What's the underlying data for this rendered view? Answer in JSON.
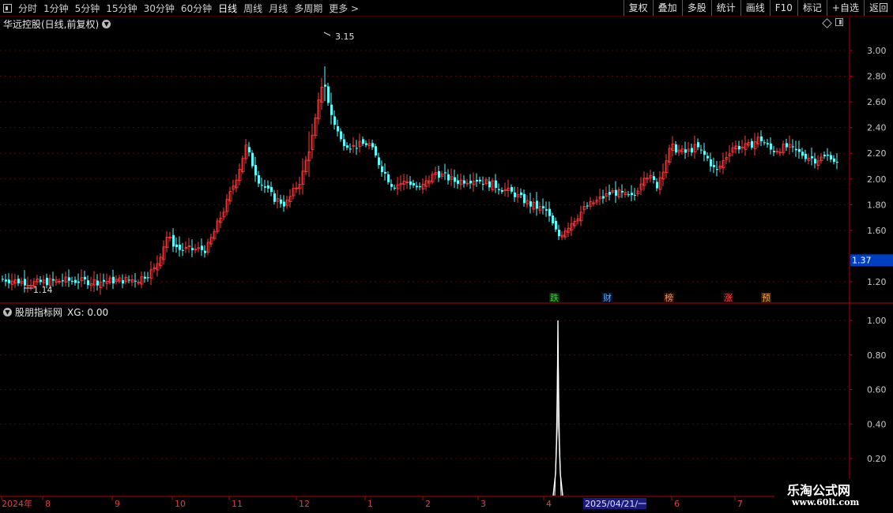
{
  "toolbar": {
    "periods": [
      "分时",
      "1分钟",
      "5分钟",
      "15分钟",
      "30分钟",
      "60分钟",
      "日线",
      "周线",
      "月线",
      "多周期",
      "更多 >"
    ],
    "active_period": "日线",
    "buttons": [
      "复权",
      "叠加",
      "多股",
      "统计",
      "画线",
      "F10",
      "标记",
      "+自选",
      "返回"
    ]
  },
  "main_chart": {
    "title": "华远控股(日线,前复权)",
    "high_label": "3.15",
    "low_label": "1.14",
    "y_axis_ticks": [
      "3.00",
      "2.80",
      "2.60",
      "2.40",
      "2.20",
      "2.00",
      "1.80",
      "1.60",
      "1.20"
    ],
    "current_price_tag": "1.37",
    "colors": {
      "up": "#ff3c3c",
      "down": "#54ffff",
      "grid": "#5a0000",
      "axis": "#b40000",
      "price_tag_bg": "#0040c0"
    },
    "signals": [
      {
        "text": "跌",
        "color": "#20e020",
        "bg": "#003000"
      },
      {
        "text": "财",
        "color": "#50b0ff",
        "bg": "#001030"
      },
      {
        "text": "榜",
        "color": "#ff9050",
        "bg": "#301000"
      },
      {
        "text": "涨",
        "color": "#ff5050",
        "bg": "#300000"
      },
      {
        "text": "预",
        "color": "#ffa040",
        "bg": "#302000"
      }
    ]
  },
  "indicator": {
    "title": "股朋指标网",
    "value_label": "XG: 0.00",
    "y_axis_ticks": [
      "1.00",
      "0.80",
      "0.60",
      "0.40",
      "0.20"
    ]
  },
  "x_axis": {
    "labels": [
      "2024年",
      "8",
      "9",
      "10",
      "11",
      "12",
      "1",
      "2",
      "3",
      "4",
      "6",
      "7"
    ],
    "cursor_date": "2025/04/21/一"
  },
  "watermark": {
    "line1": "乐淘公式网",
    "line2": "www.60lt.com"
  }
}
